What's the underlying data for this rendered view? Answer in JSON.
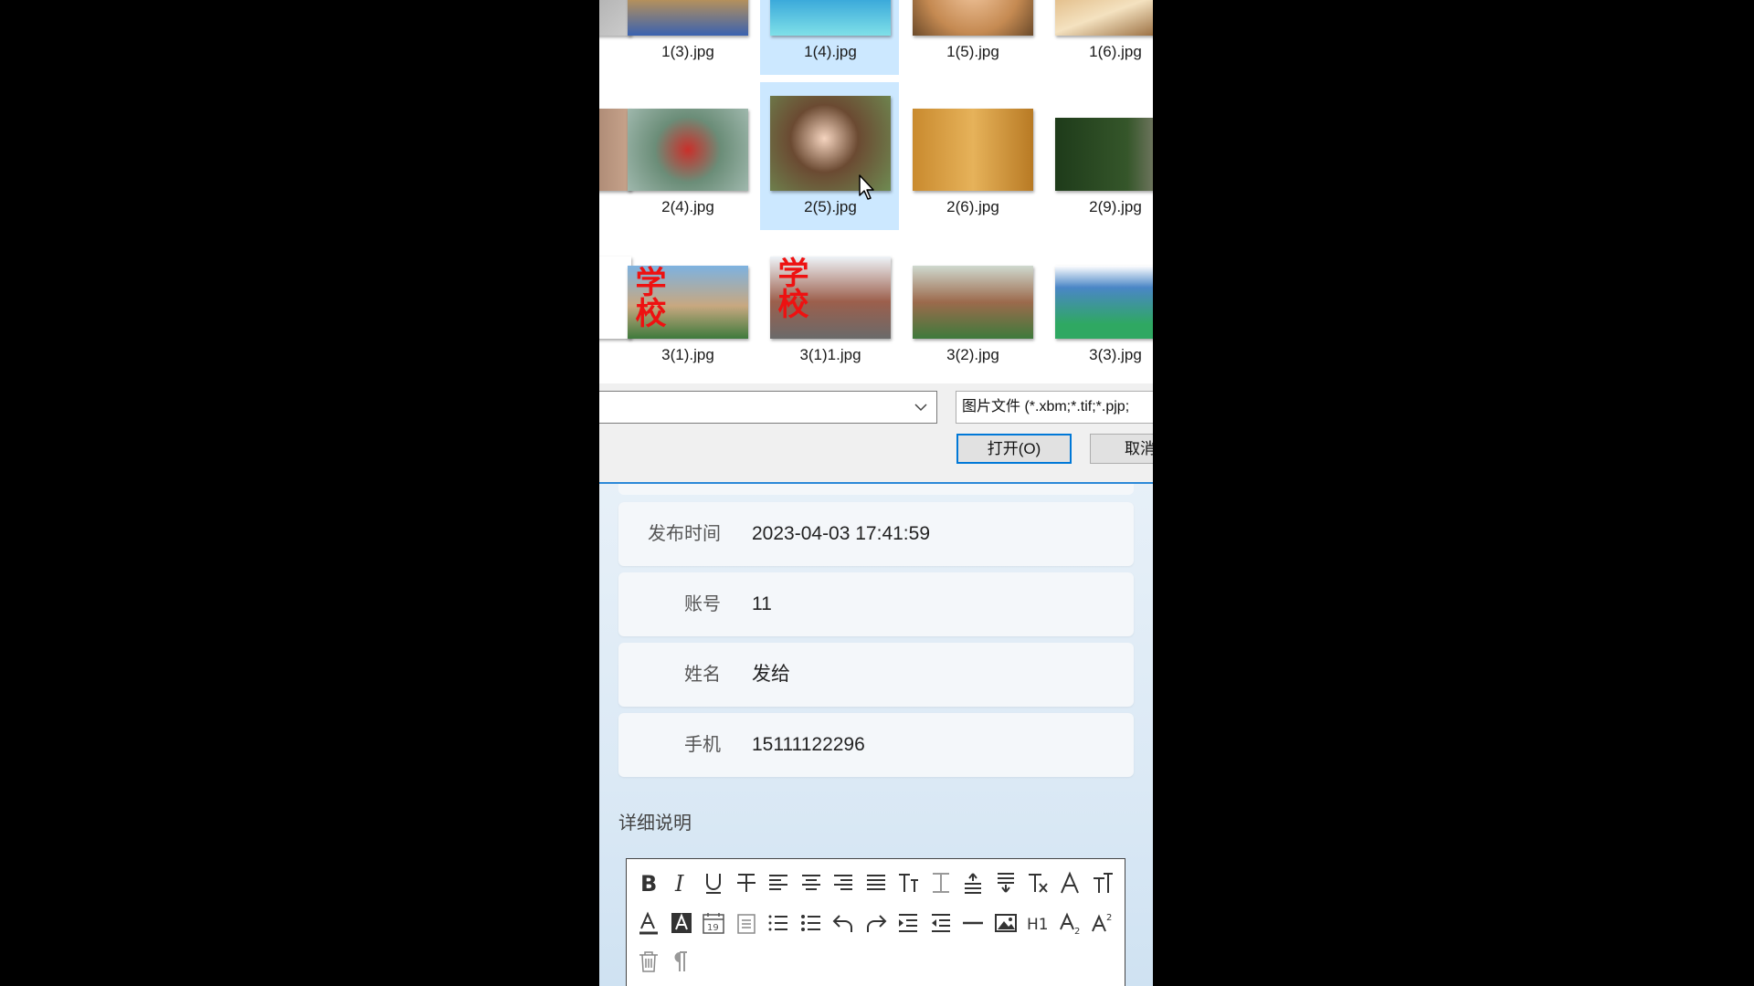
{
  "dialog": {
    "files": [
      {
        "name": "",
        "row": 0,
        "col": -1
      },
      {
        "name": "1(3).jpg",
        "row": 0,
        "col": 0
      },
      {
        "name": "1(4).jpg",
        "row": 0,
        "col": 1,
        "selected": true
      },
      {
        "name": "1(5).jpg",
        "row": 0,
        "col": 2
      },
      {
        "name": "1(6).jpg",
        "row": 0,
        "col": 3
      },
      {
        "name": "",
        "row": 1,
        "col": -1
      },
      {
        "name": "2(4).jpg",
        "row": 1,
        "col": 0
      },
      {
        "name": "2(5).jpg",
        "row": 1,
        "col": 1,
        "selected": true
      },
      {
        "name": "2(6).jpg",
        "row": 1,
        "col": 2
      },
      {
        "name": "2(9).jpg",
        "row": 1,
        "col": 3
      },
      {
        "name": "",
        "row": 2,
        "col": -1
      },
      {
        "name": "3(1).jpg",
        "row": 2,
        "col": 0,
        "overlay": "学校"
      },
      {
        "name": "3(1)1.jpg",
        "row": 2,
        "col": 1,
        "overlay": "学校"
      },
      {
        "name": "3(2).jpg",
        "row": 2,
        "col": 2
      },
      {
        "name": "3(3).jpg",
        "row": 2,
        "col": 3
      }
    ],
    "filename_value": "",
    "filetype_value": "图片文件 (*.xbm;*.tif;*.pjp;",
    "open_label": "打开(O)",
    "cancel_label": "取消"
  },
  "form": {
    "rows": [
      {
        "label": "发布时间",
        "value": "2023-04-03 17:41:59"
      },
      {
        "label": "账号",
        "value": "11"
      },
      {
        "label": "姓名",
        "value": "发给"
      },
      {
        "label": "手机",
        "value": "15111122296"
      }
    ],
    "section_title": "详细说明"
  },
  "editor_toolbar": {
    "icons": [
      "bold-icon",
      "italic-icon",
      "underline-icon",
      "strikethrough-icon",
      "align-left-icon",
      "align-center-icon",
      "align-right-icon",
      "align-justify-icon",
      "font-size-icon",
      "line-height-icon",
      "paragraph-spacing-before-icon",
      "paragraph-spacing-after-icon",
      "clear-format-icon",
      "font-family-icon",
      "text-transform-icon",
      "font-color-icon",
      "background-color-icon",
      "insert-date-icon",
      "paste-plain-icon",
      "ordered-list-icon",
      "unordered-list-icon",
      "undo-icon",
      "redo-icon",
      "indent-icon",
      "outdent-icon",
      "horizontal-rule-icon",
      "insert-image-icon",
      "heading-icon",
      "subscript-icon",
      "superscript-icon",
      "delete-icon",
      "paragraph-mark-icon"
    ]
  }
}
